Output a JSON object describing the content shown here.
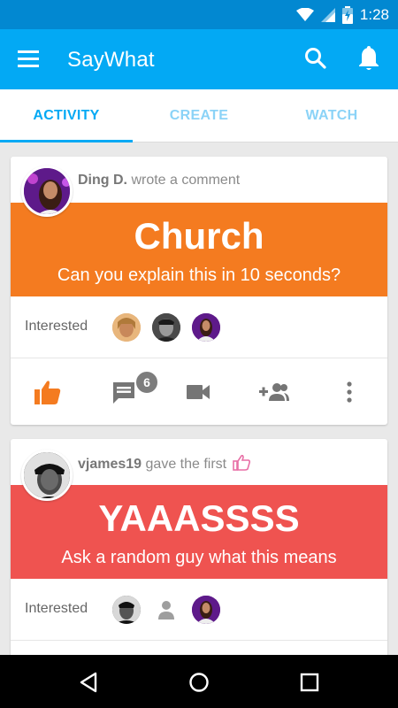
{
  "status_bar": {
    "time": "1:28"
  },
  "app_bar": {
    "title": "SayWhat"
  },
  "tabs": [
    {
      "label": "ACTIVITY",
      "active": true
    },
    {
      "label": "CREATE",
      "active": false
    },
    {
      "label": "WATCH",
      "active": false
    }
  ],
  "feed": [
    {
      "user": "Ding D.",
      "action": "wrote a comment",
      "banner_color": "#f47b20",
      "title": "Church",
      "subtitle": "Can you explain this in 10 seconds?",
      "interested_label": "Interested",
      "comment_count": "6"
    },
    {
      "user": "vjames19",
      "action": "gave the first",
      "action_icon": "thumbs-up-outline-icon",
      "banner_color": "#ef5350",
      "title": "YAAASSSS",
      "subtitle": "Ask a random guy what this means",
      "interested_label": "Interested"
    }
  ],
  "colors": {
    "primary": "#03a9f4",
    "primary_dark": "#0288d1",
    "accent_orange": "#f47b20",
    "accent_red": "#ef5350",
    "like_active": "#f47b20",
    "icon_gray": "#757575"
  }
}
